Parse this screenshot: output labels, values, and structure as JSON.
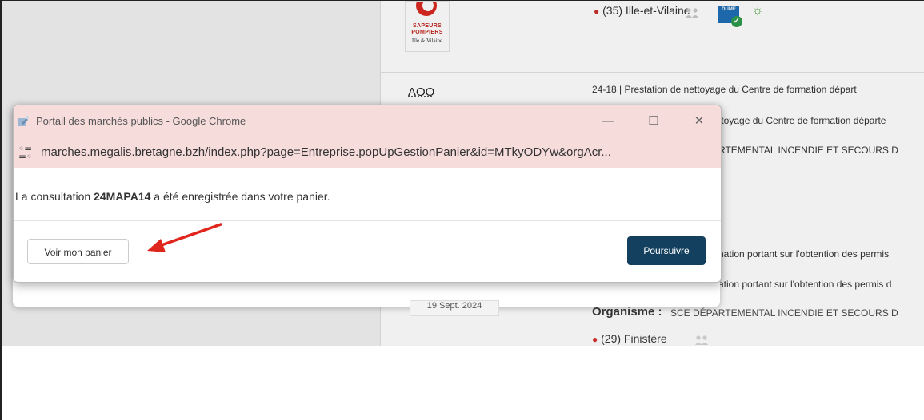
{
  "background": {
    "location_1": "(35) Ille-et-Vilaine",
    "logo": {
      "line1": "SAPEURS",
      "line2": "POMPIERS",
      "line3": "Ille & Vilaine"
    },
    "dume_label": "DUME",
    "procedure": "AOO",
    "reference_line": "24-18  |  Prestation de nettoyage du Centre de formation départ",
    "line_2": "ttoyage du Centre de formation départe",
    "line_3": "RTEMENTAL INCENDIE ET SECOURS D",
    "line_4": "nation portant sur l'obtention des permis",
    "line_5": "ation portant sur l'obtention des permis d",
    "date_chip": "19 Sept. 2024",
    "org_label": "Organisme :",
    "org_value": "SCE DÉPARTEMENTAL INCENDIE ET SECOURS D",
    "location_2": "(29) Finistère"
  },
  "popup": {
    "window_title": "Portail des marchés publics - Google Chrome",
    "url": "marches.megalis.bretagne.bzh/index.php?page=Entreprise.popUpGestionPanier&id=MTkyODYw&orgAcr...",
    "message_pre": "La consultation ",
    "consultation_ref": "24MAPA14",
    "message_post": " a été enregistrée dans votre panier.",
    "btn_view_cart": "Voir mon panier",
    "btn_continue": "Poursuivre",
    "minimize_symbol": "—",
    "maximize_symbol": "☐",
    "close_symbol": "✕"
  },
  "colors": {
    "titlebar_bg": "#f7dcdc",
    "primary_button": "#14405f",
    "annotation_arrow": "#e0251c"
  },
  "icons": [
    "chrome-app-icon",
    "site-settings-icon",
    "location-pin-icon",
    "people-icon",
    "dume-icon",
    "sun-icon",
    "annotation-arrow"
  ]
}
